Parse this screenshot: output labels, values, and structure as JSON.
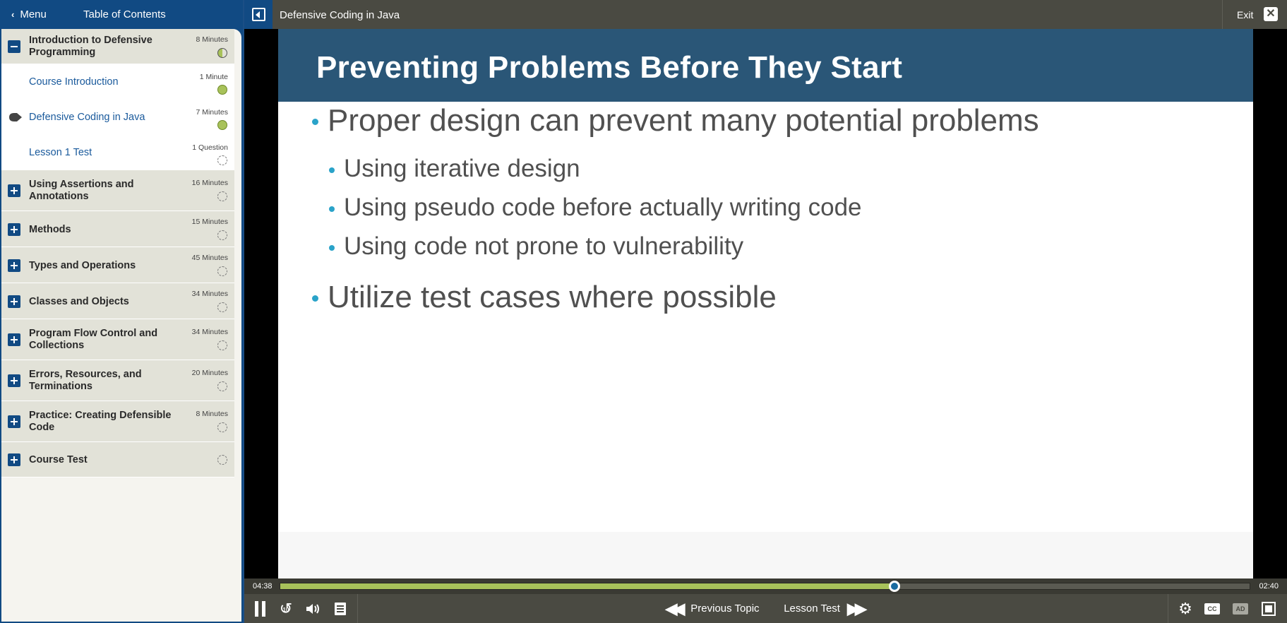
{
  "sidebar": {
    "menu_label": "Menu",
    "toc_title": "Table of Contents",
    "sections": [
      {
        "title": "Introduction to Defensive Programming",
        "duration": "8 Minutes",
        "status": "half",
        "expanded": true
      },
      {
        "title": "Using Assertions and Annotations",
        "duration": "16 Minutes",
        "status": "empty"
      },
      {
        "title": "Methods",
        "duration": "15 Minutes",
        "status": "empty"
      },
      {
        "title": "Types and Operations",
        "duration": "45 Minutes",
        "status": "empty"
      },
      {
        "title": "Classes and Objects",
        "duration": "34 Minutes",
        "status": "empty"
      },
      {
        "title": "Program Flow Control and Collections",
        "duration": "34 Minutes",
        "status": "empty"
      },
      {
        "title": "Errors, Resources, and Terminations",
        "duration": "20 Minutes",
        "status": "empty"
      },
      {
        "title": "Practice: Creating Defensible Code",
        "duration": "8 Minutes",
        "status": "empty"
      },
      {
        "title": "Course Test",
        "duration": "",
        "status": "empty"
      }
    ],
    "lessons": [
      {
        "title": "Course Introduction",
        "duration": "1 Minute",
        "status": "done"
      },
      {
        "title": "Defensive Coding in Java",
        "duration": "7 Minutes",
        "status": "done",
        "current": true
      },
      {
        "title": "Lesson 1 Test",
        "duration": "1 Question",
        "status": "empty"
      }
    ]
  },
  "topbar": {
    "video_title": "Defensive Coding in Java",
    "exit_label": "Exit"
  },
  "slide": {
    "title": "Preventing Problems Before They Start",
    "bullets": [
      "Proper design can prevent many potential problems",
      "Using iterative design",
      "Using pseudo code before actually writing code",
      "Using code not prone to vulnerability",
      "Utilize test cases where possible"
    ]
  },
  "player": {
    "time_elapsed": "04:38",
    "time_remaining": "02:40",
    "progress_fraction": 0.634,
    "rewind_seconds": "10",
    "prev_label": "Previous Topic",
    "next_label": "Lesson Test",
    "cc_label": "CC",
    "ad_label": "AD"
  },
  "colors": {
    "brand_blue": "#114a83",
    "progress_green": "#a8c25a",
    "slide_header": "#2a5677",
    "bullet_dot": "#2aa3c9"
  }
}
